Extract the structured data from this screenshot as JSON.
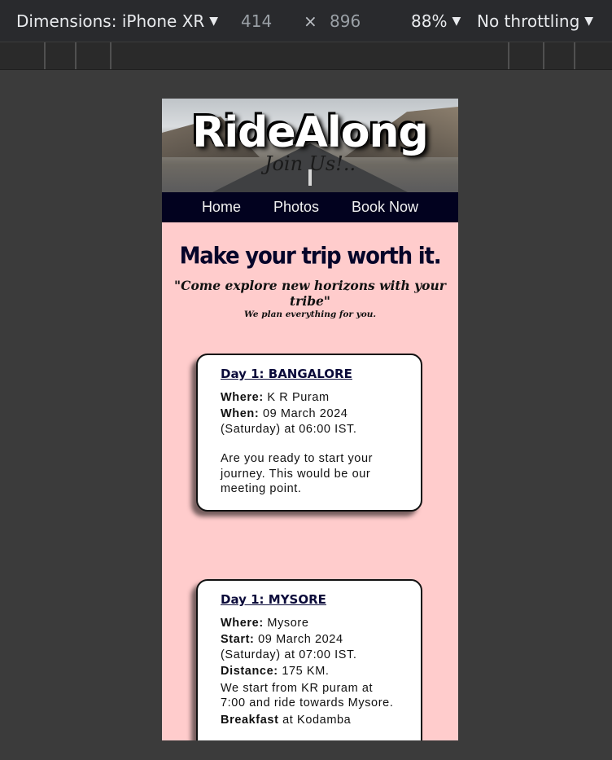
{
  "devtools": {
    "dimensions_label": "Dimensions: iPhone XR",
    "width": "414",
    "times": "×",
    "height": "896",
    "zoom": "88%",
    "throttling": "No throttling"
  },
  "page": {
    "brand": "RideAlong",
    "tagline": "Join Us!..",
    "nav": [
      "Home",
      "Photos",
      "Book Now"
    ],
    "headline": "Make your trip worth it.",
    "quote": "\"Come explore new horizons with your tribe\"",
    "subquote": "We plan everything for you.",
    "cards": [
      {
        "title": "Day 1: BANGALORE",
        "where_label": "Where:",
        "where_value": "K R Puram",
        "when_label": "When:",
        "when_value": "09 March 2024 (Saturday) at 06:00 IST.",
        "description": "Are you ready to start your journey. This would be our meeting point."
      },
      {
        "title": "Day 1: MYSORE",
        "where_label": "Where:",
        "where_value": "Mysore",
        "start_label": "Start:",
        "start_value": "09 March 2024 (Saturday) at 07:00 IST.",
        "distance_label": "Distance:",
        "distance_value": "175 KM.",
        "description": "We start from KR puram at 7:00 and ride towards Mysore.",
        "breakfast_label": "Breakfast",
        "breakfast_value": "at Kodamba"
      }
    ]
  }
}
